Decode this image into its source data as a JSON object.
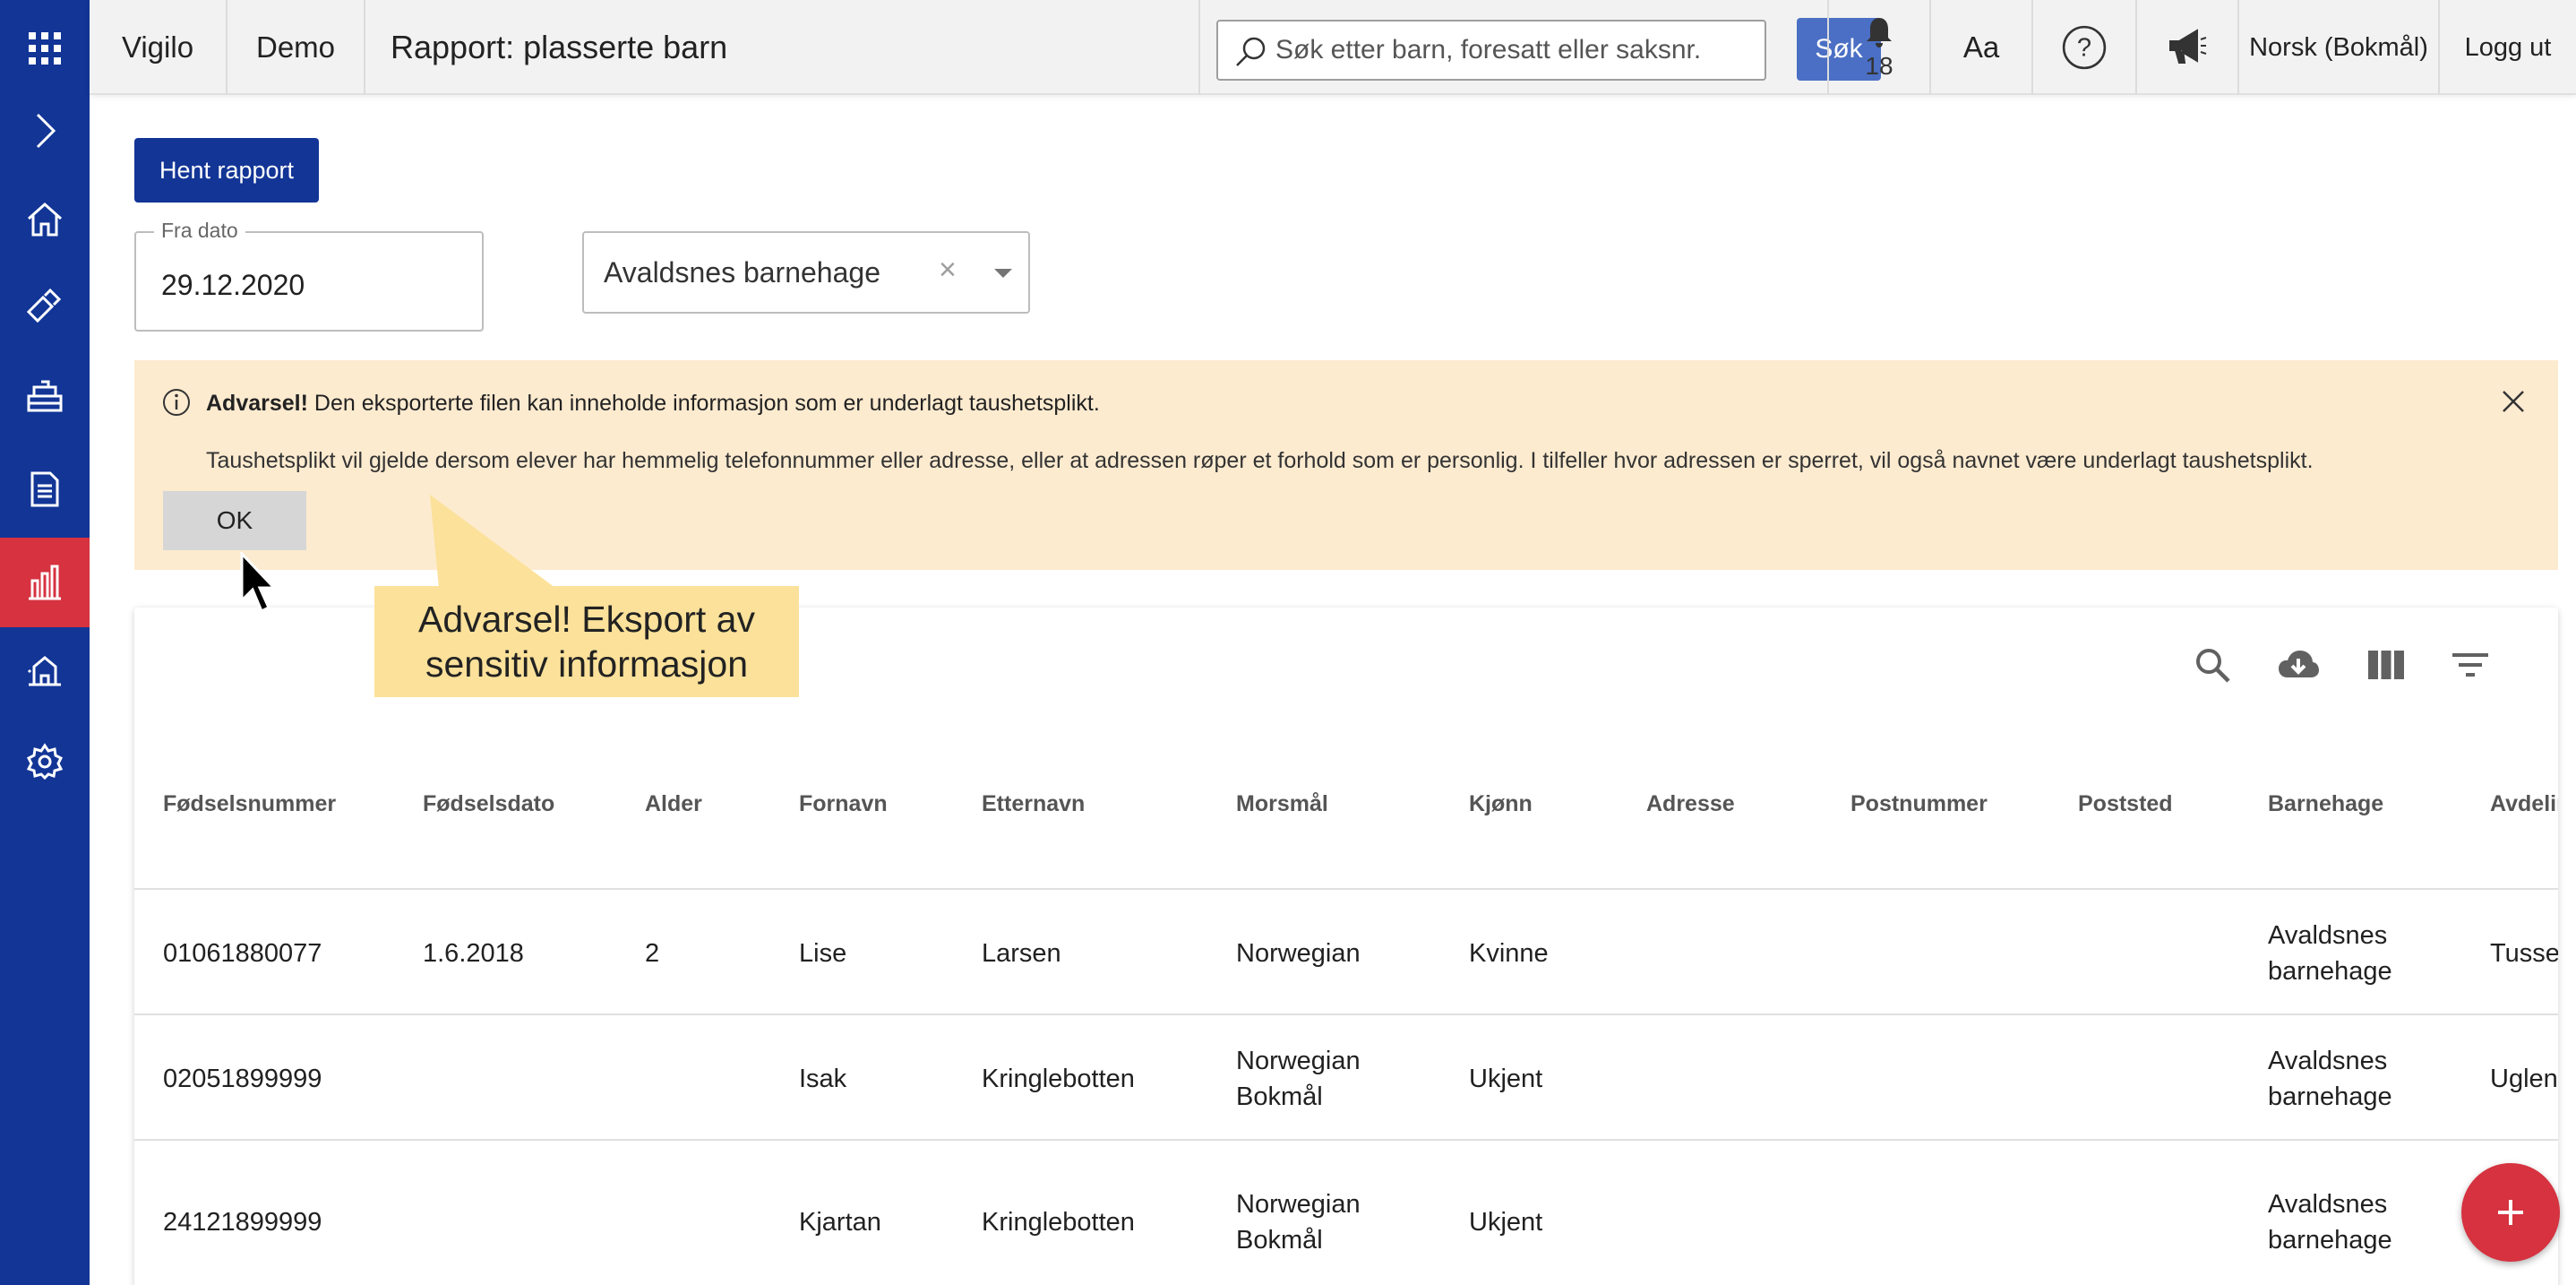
{
  "topbar": {
    "app_name": "Vigilo",
    "org_name": "Demo",
    "page_title": "Rapport: plasserte barn",
    "search_placeholder": "Søk etter barn, foresatt eller saksnr.",
    "search_button": "Søk",
    "notification_count": "18",
    "font_size_label": "Aa",
    "language": "Norsk (Bokmål)",
    "logout": "Logg ut"
  },
  "sidebar": {
    "items": [
      "apps-icon",
      "expand-icon",
      "home-icon",
      "pencil-ruler-icon",
      "cradle-icon",
      "document-icon",
      "chart-icon",
      "building-icon",
      "settings-icon"
    ],
    "active": "chart-icon"
  },
  "main": {
    "fetch_button": "Hent rapport",
    "date_label": "Fra dato",
    "date_value": "29.12.2020",
    "kindergarten_value": "Avaldsnes barnehage",
    "clear_symbol": "×"
  },
  "warning": {
    "title": "Advarsel!",
    "line1": " Den eksporterte filen kan inneholde informasjon som er underlagt taushetsplikt.",
    "line2": "Taushetsplikt vil gjelde dersom elever har hemmelig telefonnummer eller adresse, eller at adressen røper et forhold som er personlig. I tilfeller hvor adressen er sperret, vil også navnet være underlagt taushetsplikt.",
    "ok_button": "OK"
  },
  "callout": {
    "line1": "Advarsel! Eksport av",
    "line2": "sensitiv informasjon"
  },
  "table": {
    "headers": [
      "Fødselsnummer",
      "Fødselsdato",
      "Alder",
      "Fornavn",
      "Etternavn",
      "Morsmål",
      "Kjønn",
      "Adresse",
      "Postnummer",
      "Poststed",
      "Barnehage",
      "Avdelin"
    ],
    "rows": [
      {
        "fnr": "01061880077",
        "dob": "1.6.2018",
        "age": "2",
        "first": "Lise",
        "last": "Larsen",
        "lang1": "Norwegian",
        "lang2": "",
        "gender": "Kvinne",
        "kg1": "Avaldsnes",
        "kg2": "barnehage",
        "dept": "Tusse"
      },
      {
        "fnr": "02051899999",
        "dob": "",
        "age": "",
        "first": "Isak",
        "last": "Kringlebotten",
        "lang1": "Norwegian",
        "lang2": "Bokmål",
        "gender": "Ukjent",
        "kg1": "Avaldsnes",
        "kg2": "barnehage",
        "dept": "Uglen"
      },
      {
        "fnr": "24121899999",
        "dob": "",
        "age": "",
        "first": "Kjartan",
        "last": "Kringlebotten",
        "lang1": "Norwegian",
        "lang2": "Bokmål",
        "gender": "Ukjent",
        "kg1": "Avaldsnes",
        "kg2": "barnehage",
        "dept": ""
      }
    ]
  },
  "colors": {
    "sidebar": "#123596",
    "active": "#d6323f",
    "warning_bg": "#fdebd0",
    "callout_bg": "#fbe19a",
    "primary_button": "#123596",
    "search_button": "#4a6fc4"
  }
}
